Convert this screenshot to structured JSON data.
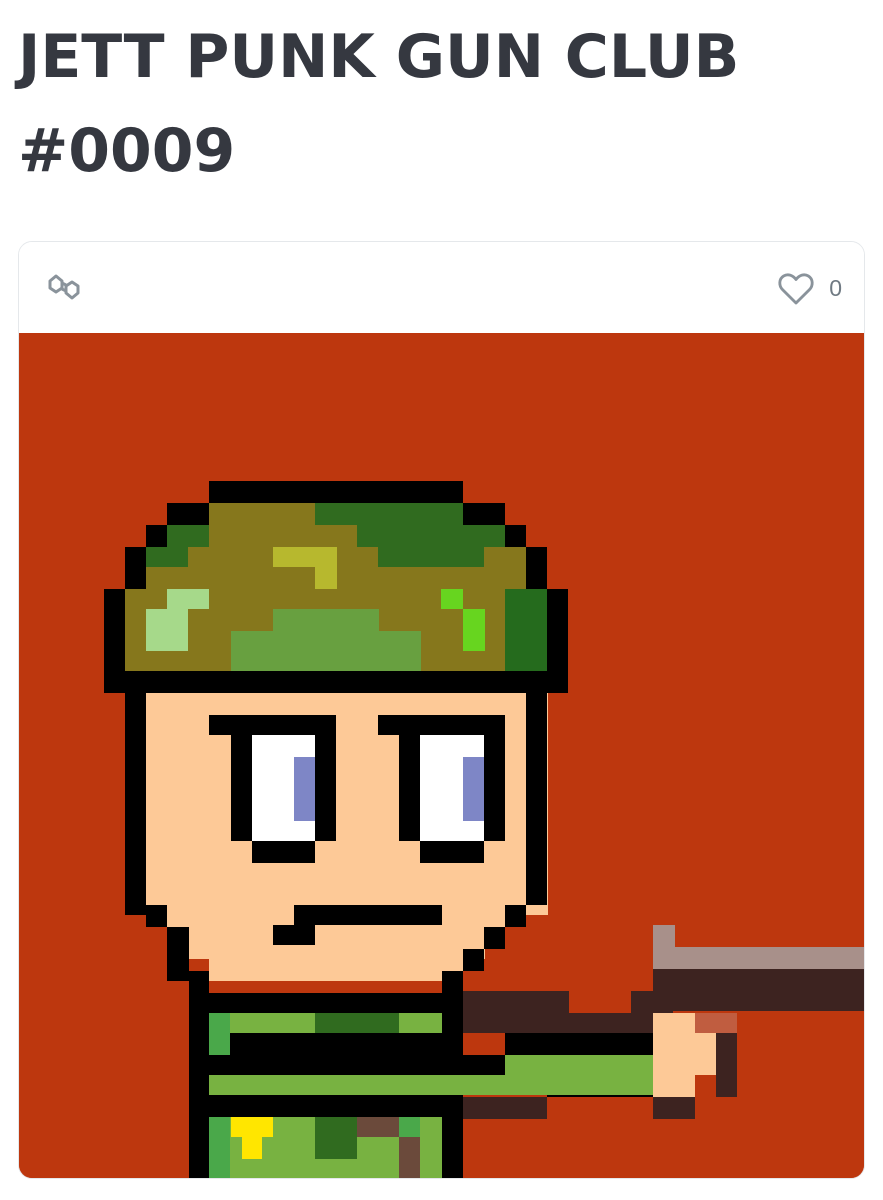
{
  "item": {
    "title_line1": "JETT PUNK GUN CLUB",
    "title_line2": "#0009"
  },
  "card": {
    "chain_icon": "polygon-chain-icon",
    "like_icon": "heart-icon",
    "like_count": "0"
  },
  "artwork": {
    "description_icon": "pixel-art-soldier-with-gun",
    "background_color": "#bd370e"
  }
}
